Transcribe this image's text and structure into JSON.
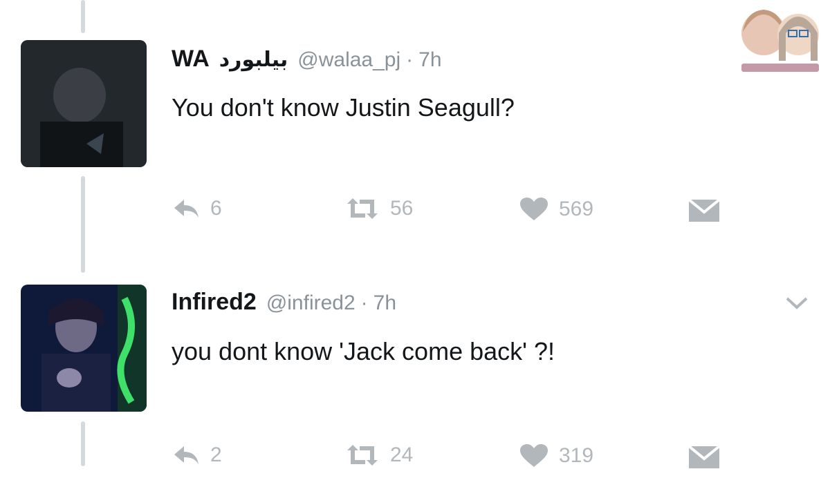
{
  "tweets": [
    {
      "name": "WA",
      "name_arabic": "بيلبورد",
      "handle": "@walaa_pj",
      "separator": "·",
      "time": "7h",
      "text": "You don't know Justin Seagull?",
      "replies": "6",
      "retweets": "56",
      "likes": "569",
      "avatar_icon": "person-photo-dark"
    },
    {
      "name": "Infired2",
      "handle": "@infired2",
      "separator": "·",
      "time": "7h",
      "text": "you dont know 'Jack come back' ?!",
      "replies": "2",
      "retweets": "24",
      "likes": "319",
      "avatar_icon": "person-photo-green-light"
    }
  ],
  "colors": {
    "text": "#14171a",
    "muted": "#8a9299",
    "icon": "#b2b7bb",
    "thread_line": "#d6d9db"
  }
}
